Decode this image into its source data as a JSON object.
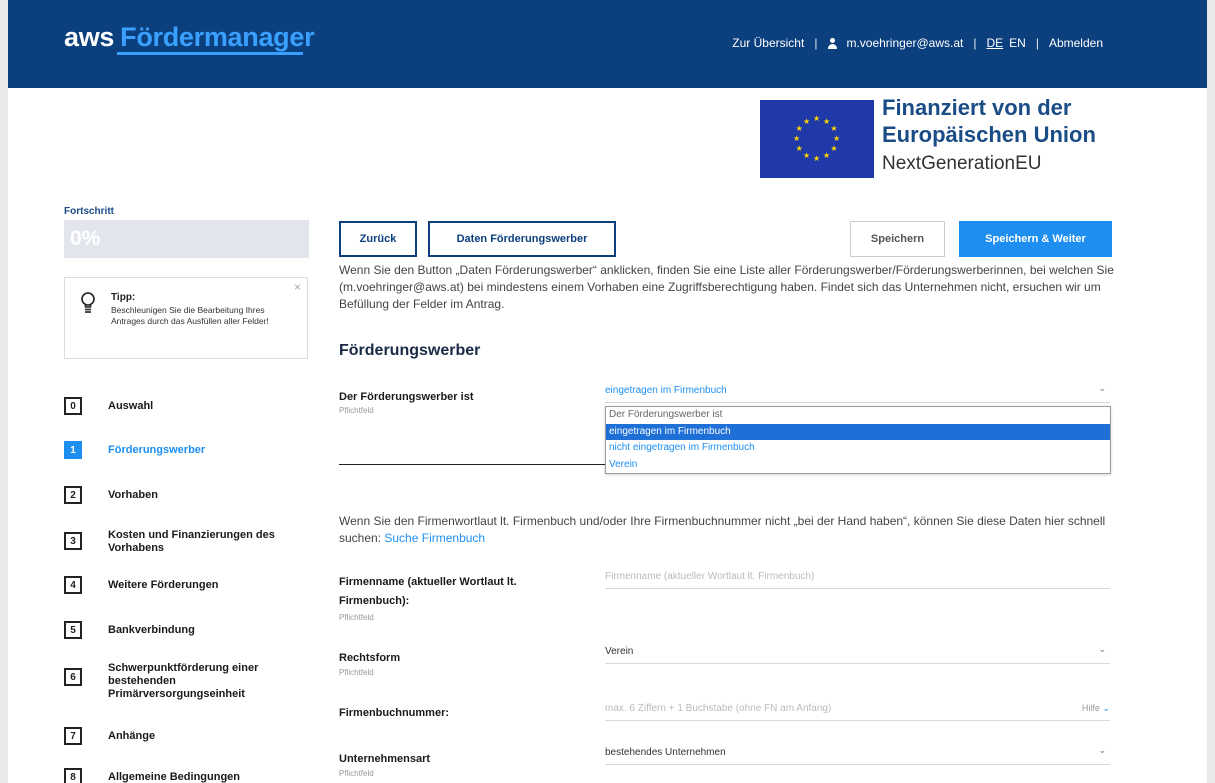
{
  "header": {
    "logo_prefix": "aws",
    "logo_name": "Fördermanager",
    "nav_overview": "Zur Übersicht",
    "user_email": "m.voehringer@aws.at",
    "lang_de": "DE",
    "lang_en": "EN",
    "logout": "Abmelden"
  },
  "eu_banner": {
    "line1": "Finanziert von der",
    "line2": "Europäischen Union",
    "line3": "NextGenerationEU",
    "flag_color": "#1f3aa8",
    "star_color": "#ffd400"
  },
  "sidebar": {
    "progress_label": "Fortschritt",
    "progress_value": "0%",
    "progress_fraction": 0,
    "tip_title": "Tipp:",
    "tip_text": "Beschleunigen Sie die Bearbeitung Ihres Antrages durch das Ausfüllen aller Felder!",
    "tip_close": "×",
    "steps": [
      {
        "num": "0",
        "label": "Auswahl"
      },
      {
        "num": "1",
        "label": "Förderungswerber",
        "active": true
      },
      {
        "num": "2",
        "label": "Vorhaben"
      },
      {
        "num": "3",
        "label": "Kosten und Finanzierungen des Vorhabens"
      },
      {
        "num": "4",
        "label": "Weitere Förderungen"
      },
      {
        "num": "5",
        "label": "Bankverbindung"
      },
      {
        "num": "6",
        "label": "Schwerpunktförderung einer bestehenden Primärversorgungseinheit"
      },
      {
        "num": "7",
        "label": "Anhänge"
      },
      {
        "num": "8",
        "label": "Allgemeine Bedingungen"
      }
    ]
  },
  "toolbar": {
    "back": "Zurück",
    "applicant_data": "Daten Förderungswerber",
    "save": "Speichern",
    "save_next": "Speichern & Weiter"
  },
  "main": {
    "info_text": "Wenn Sie den Button „Daten Förderungswerber“ anklicken, finden Sie eine Liste aller Förderungswerber/Förderungswerberinnen, bei welchen Sie (m.voehringer@aws.at) bei mindestens einem Vorhaben eine Zugriffsberechtigung haben. Findet sich das Unternehmen nicht, ersuchen wir um Befüllung der Felder im Antrag.",
    "section_title": "Förderungswerber",
    "required": "Pflichtfeld",
    "applicant_type": {
      "label": "Der Förderungswerber ist",
      "value": "eingetragen im Firmenbuch",
      "options": [
        "Der Förderungswerber ist",
        "eingetragen im Firmenbuch",
        "nicht eingetragen im Firmenbuch",
        "Verein"
      ],
      "selected_index": 1
    },
    "search_info": "Wenn Sie den Firmenwortlaut lt. Firmenbuch und/oder Ihre Firmenbuchnummer nicht „bei der Hand haben“, können Sie diese Daten hier schnell suchen:",
    "search_link": "Suche Firmenbuch",
    "company_name": {
      "label": "Firmenname (aktueller Wortlaut lt. Firmenbuch):",
      "placeholder": "Firmenname (aktueller Wortlaut lt. Firmenbuch)"
    },
    "legal_form": {
      "label": "Rechtsform",
      "value": "Verein"
    },
    "register_number": {
      "label": "Firmenbuchnummer:",
      "placeholder": "max. 6 Ziffern + 1 Buchstabe (ohne FN am Anfang)",
      "help": "Hilfe"
    },
    "company_type": {
      "label": "Unternehmensart",
      "value": "bestehendes Unternehmen"
    }
  },
  "colors": {
    "header_bg": "#0b3f7d",
    "accent": "#1e8ff0",
    "dropdown_selected": "#1e6fd6"
  }
}
